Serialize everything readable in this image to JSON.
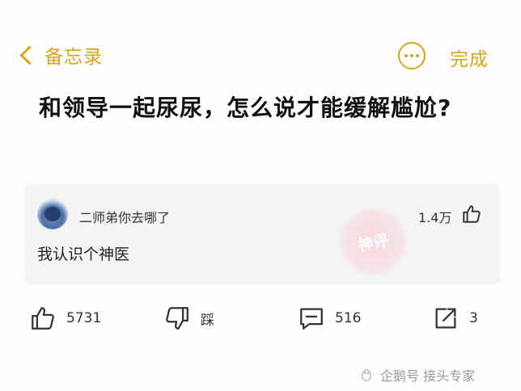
{
  "header": {
    "back_label": "备忘录",
    "done_label": "完成",
    "accent_color": "#d9a514"
  },
  "title": "和领导一起尿尿，怎么说才能缓解尴尬?",
  "comment": {
    "username": "二师弟你去哪了",
    "likes": "1.4万",
    "text": "我认识个神医",
    "badge": "神评"
  },
  "actions": {
    "like_count": "5731",
    "dislike_label": "踩",
    "comment_count": "516",
    "share_count": "3"
  },
  "watermark": {
    "text": "企鹅号 接头专家"
  },
  "icons": [
    "back-chevron-icon",
    "more-icon",
    "thumbs-up-icon",
    "thumbs-down-icon",
    "comment-icon",
    "share-icon"
  ]
}
